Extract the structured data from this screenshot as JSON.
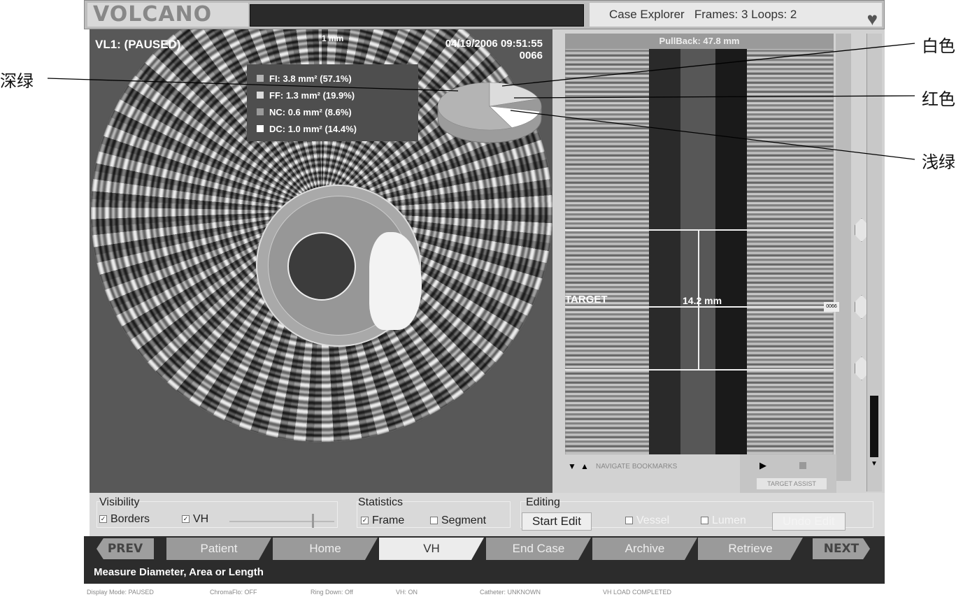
{
  "topbar": {
    "logo": "VOLCANO",
    "case_explorer": "Case Explorer",
    "frames": "Frames: 3",
    "loops": "Loops: 2"
  },
  "ivus": {
    "status": "VL1: (PAUSED)",
    "scale": "1 mm",
    "datetime": "04/19/2006 09:51:55",
    "frame": "0066",
    "legend": [
      {
        "label": "FI: 3.8 mm² (57.1%)",
        "color": "#b4b4b4"
      },
      {
        "label": "FF: 1.3 mm² (19.9%)",
        "color": "#dcdcdc"
      },
      {
        "label": "NC: 0.6 mm² (8.6%)",
        "color": "#9a9a9a"
      },
      {
        "label": "DC: 1.0 mm² (14.4%)",
        "color": "#ffffff"
      }
    ]
  },
  "chart_data": {
    "type": "pie",
    "categories": [
      "FI",
      "FF",
      "NC",
      "DC"
    ],
    "values": [
      57.1,
      19.9,
      8.6,
      14.4
    ],
    "colors": [
      "#b4b4b4",
      "#dcdcdc",
      "#9a9a9a",
      "#ffffff"
    ]
  },
  "longview": {
    "pullback": "PullBack: 47.8 mm",
    "target": "TARGET",
    "measure": "14.2 mm",
    "navigate": "NAVIGATE BOOKMARKS",
    "target_assist": "TARGET ASSIST",
    "frame_tag": "0066"
  },
  "controls": {
    "visibility": {
      "title": "Visibility",
      "borders": "Borders",
      "vh": "VH"
    },
    "statistics": {
      "title": "Statistics",
      "frame": "Frame",
      "segment": "Segment"
    },
    "editing": {
      "title": "Editing",
      "start_edit": "Start Edit",
      "vessel": "Vessel",
      "lumen": "Lumen",
      "undo_edit": "Undo Edit"
    }
  },
  "nav": {
    "prev": "PREV",
    "next": "NEXT",
    "tabs": [
      "Patient",
      "Home",
      "VH",
      "End Case",
      "Archive",
      "Retrieve"
    ]
  },
  "message": "Measure Diameter, Area or Length",
  "statusbar": [
    "Display Mode: PAUSED",
    "ChromaFlo: OFF",
    "Ring Down: Off",
    "VH: ON",
    "Catheter: UNKNOWN",
    "VH LOAD COMPLETED"
  ],
  "annotations": {
    "dark_green": "深绿",
    "white": "白色",
    "red": "红色",
    "light_green": "浅绿"
  }
}
